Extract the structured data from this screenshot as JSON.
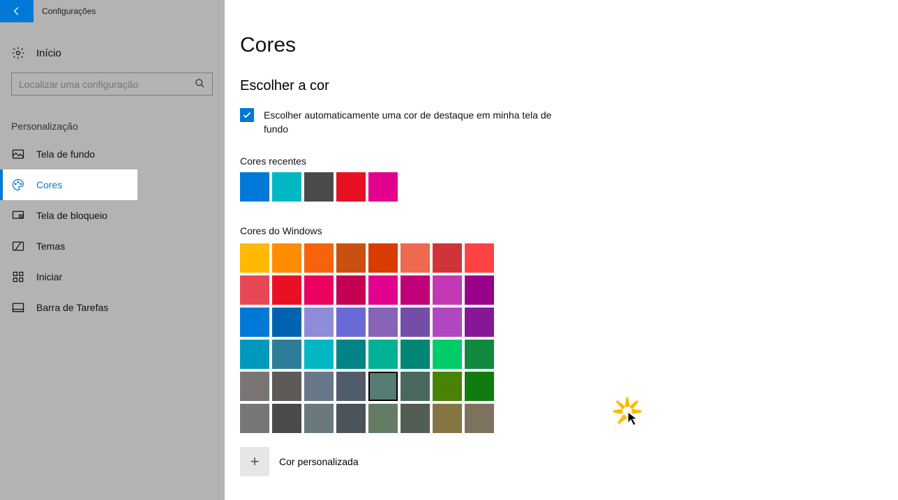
{
  "app": {
    "title": "Configurações"
  },
  "sidebar": {
    "home": "Início",
    "search_placeholder": "Localizar uma configuração",
    "category": "Personalização",
    "items": [
      {
        "label": "Tela de fundo"
      },
      {
        "label": "Cores"
      },
      {
        "label": "Tela de bloqueio"
      },
      {
        "label": "Temas"
      },
      {
        "label": "Iniciar"
      },
      {
        "label": "Barra de Tarefas"
      }
    ]
  },
  "main": {
    "title": "Cores",
    "section_choose": "Escolher a cor",
    "auto_check_label": "Escolher automaticamente uma cor de destaque em minha tela de fundo",
    "auto_check_checked": true,
    "recent_label": "Cores recentes",
    "recent_colors": [
      "#0078d7",
      "#00b7c3",
      "#4c4a48",
      "#e81123",
      "#e3008c"
    ],
    "windows_label": "Cores do Windows",
    "windows_colors": [
      "#ffb900",
      "#ff8c00",
      "#f7630c",
      "#ca5010",
      "#da3b01",
      "#ef6950",
      "#d13438",
      "#ff4343",
      "#e74856",
      "#e81123",
      "#ea005e",
      "#c30052",
      "#e3008c",
      "#bf0077",
      "#c239b3",
      "#9a0089",
      "#0078d7",
      "#0063b1",
      "#8e8cd8",
      "#6b69d6",
      "#8764b8",
      "#744da9",
      "#b146c2",
      "#881798",
      "#0099bc",
      "#2d7d9a",
      "#00b7c3",
      "#038387",
      "#00b294",
      "#018574",
      "#00cc6a",
      "#10893e",
      "#7a7574",
      "#5d5a58",
      "#68768a",
      "#515c6b",
      "#567c73",
      "#486860",
      "#498205",
      "#107c10",
      "#767676",
      "#4c4a48",
      "#69797e",
      "#4a5459",
      "#647c64",
      "#525e54",
      "#847545",
      "#7e735f"
    ],
    "selected_color_index": 36,
    "custom_label": "Cor personalizada"
  }
}
